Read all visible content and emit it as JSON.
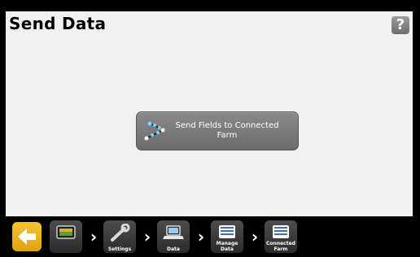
{
  "header": {
    "title": "Send Data",
    "help_glyph": "?"
  },
  "main": {
    "send_button_label": "Send Fields to Connected Farm",
    "send_icon": "transfer-arrows-icon"
  },
  "breadcrumb": {
    "back_icon": "back-arrow-icon",
    "home_icon": "monitor-icon",
    "items": [
      {
        "label": "Settings",
        "icon": "wrench-icon"
      },
      {
        "label": "Data",
        "icon": "laptop-icon"
      },
      {
        "label": "Manage Data",
        "icon": "list-icon"
      },
      {
        "label": "Connected Farm",
        "icon": "list-icon"
      }
    ]
  },
  "colors": {
    "accent": "#f0b321",
    "panel": "#f1f1f1",
    "button": "#7a7a7a"
  }
}
